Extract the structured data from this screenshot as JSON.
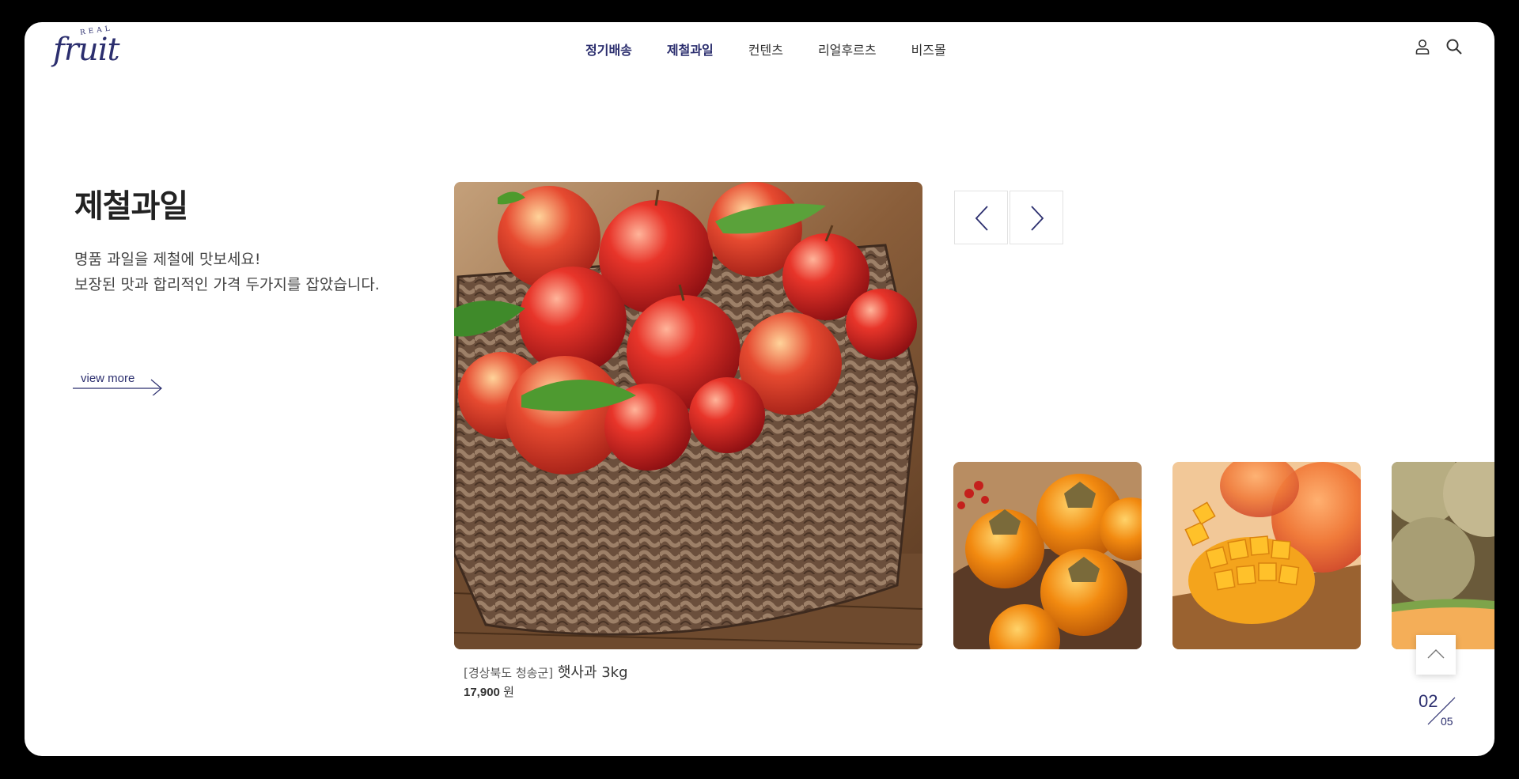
{
  "header": {
    "logo_small": "REAL",
    "logo_main": "fruit",
    "nav": [
      {
        "label": "정기배송",
        "active": true
      },
      {
        "label": "제철과일",
        "active": true
      },
      {
        "label": "컨텐츠",
        "active": false
      },
      {
        "label": "리얼후르츠",
        "active": false
      },
      {
        "label": "비즈몰",
        "active": false
      }
    ],
    "icons": [
      "user-icon",
      "search-icon"
    ]
  },
  "section": {
    "title": "제철과일",
    "desc_line1": "명품 과일을 제철에 맛보세요!",
    "desc_line2": "보장된 맛과 합리적인 가격 두가지를 잡았습니다.",
    "view_more": "view more"
  },
  "featured": {
    "region": "[경상북도 청송군]",
    "name": "햇사과 3kg",
    "price": "17,900",
    "currency": "원",
    "image": "apples-in-basket"
  },
  "thumbnails": [
    {
      "image": "persimmons"
    },
    {
      "image": "mango"
    },
    {
      "image": "melon"
    }
  ],
  "pagination": {
    "current": "02",
    "total": "05"
  },
  "colors": {
    "brand": "#2b2e6e",
    "text": "#333333",
    "border": "#e2e2e2"
  }
}
